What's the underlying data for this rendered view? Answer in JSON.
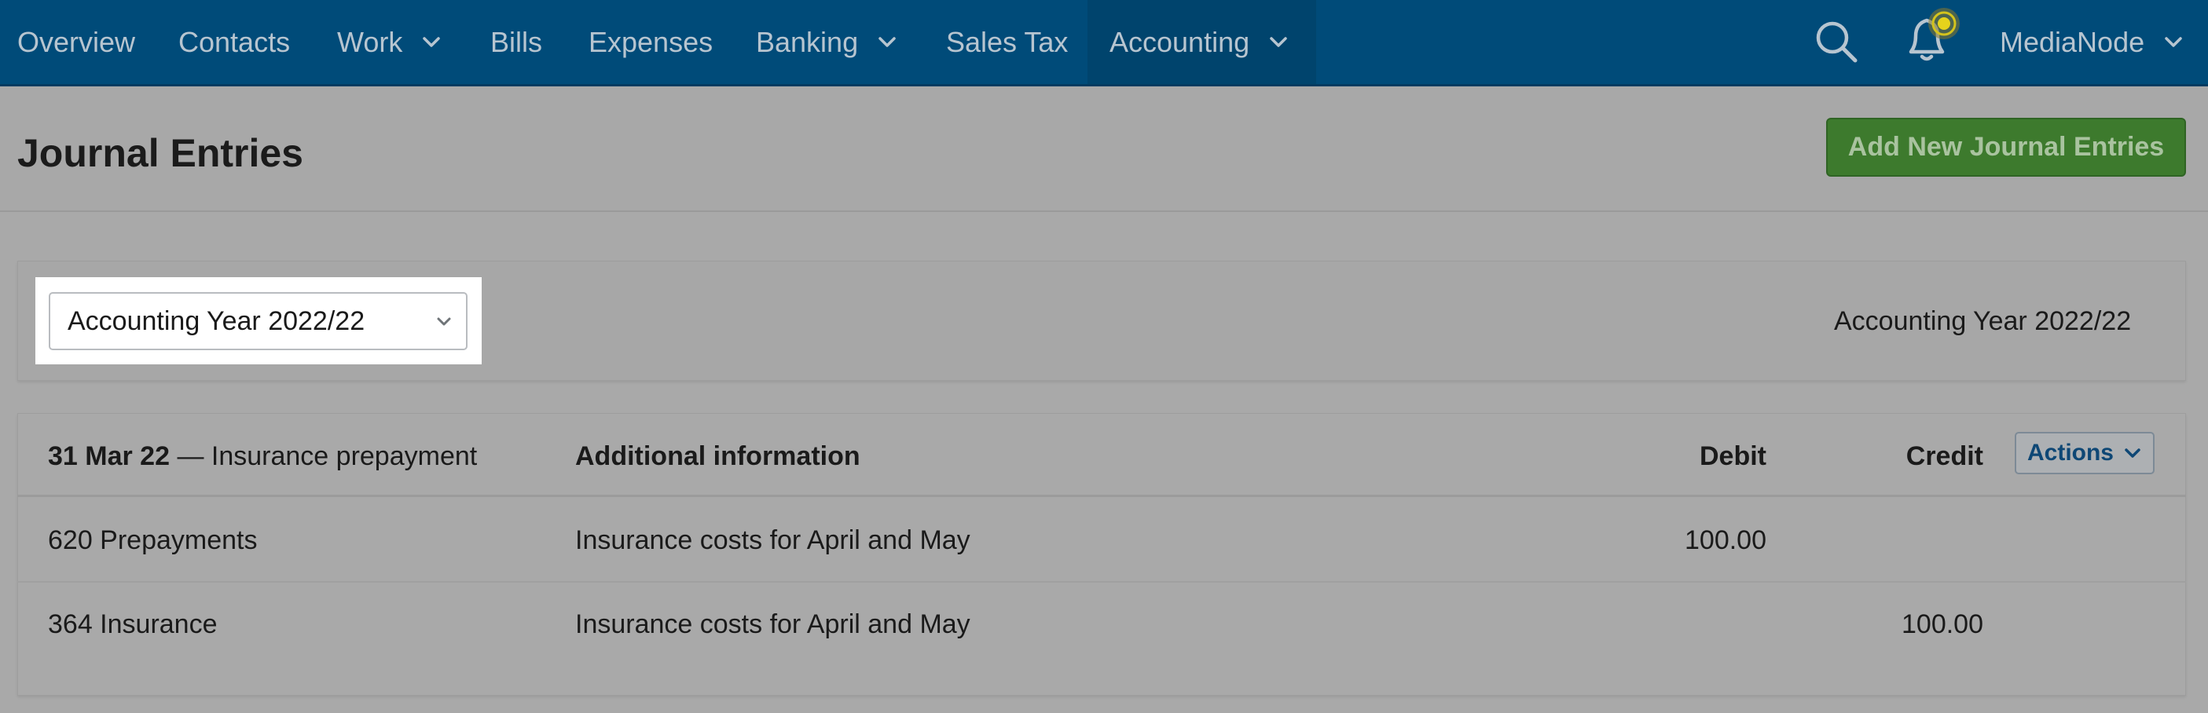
{
  "nav": {
    "items": [
      {
        "label": "Overview"
      },
      {
        "label": "Contacts"
      },
      {
        "label": "Work"
      },
      {
        "label": "Bills"
      },
      {
        "label": "Expenses"
      },
      {
        "label": "Banking"
      },
      {
        "label": "Sales Tax"
      },
      {
        "label": "Accounting"
      }
    ],
    "account_label": "MediaNode",
    "icons": {
      "search": "search-icon",
      "notifications": "bell-icon"
    }
  },
  "page": {
    "title": "Journal Entries",
    "add_button_label": "Add New Journal Entries"
  },
  "filter": {
    "selected_year": "Accounting Year 2022/22",
    "year_label": "Accounting Year 2022/22"
  },
  "journal": {
    "entry_date": "31 Mar 22",
    "entry_separator": "—",
    "entry_description": "Insurance prepayment",
    "columns": {
      "info": "Additional information",
      "debit": "Debit",
      "credit": "Credit"
    },
    "actions_label": "Actions",
    "rows": [
      {
        "account": "620 Prepayments",
        "info": "Insurance costs for April and May",
        "debit": "100.00",
        "credit": ""
      },
      {
        "account": "364 Insurance",
        "info": "Insurance costs for April and May",
        "debit": "",
        "credit": "100.00"
      }
    ]
  },
  "colors": {
    "nav_background": "#004b79",
    "add_button": "#3d7a2d",
    "actions_text": "#0e4775",
    "notification_dot": "#e5d31c"
  }
}
